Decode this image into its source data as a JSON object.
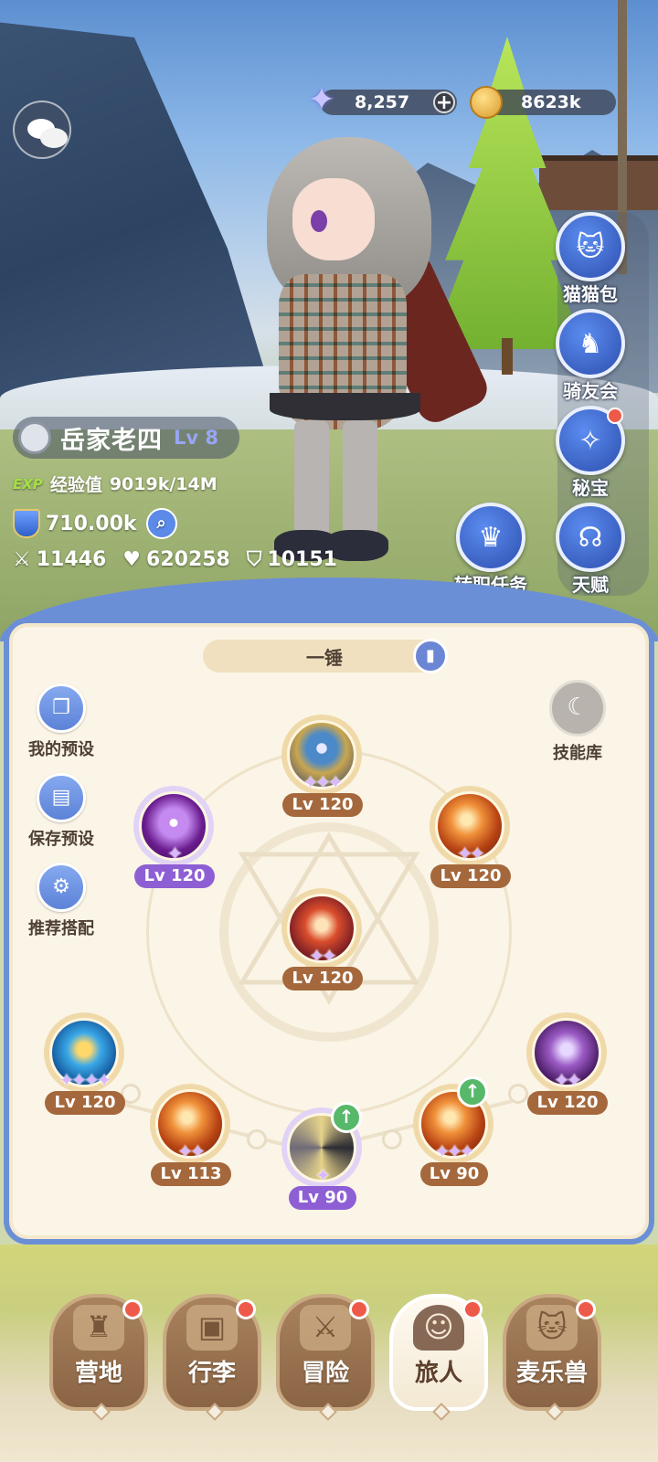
{
  "currency": {
    "gems": "8,257",
    "gold": "8623k"
  },
  "player": {
    "name": "岳家老四",
    "level": "Lv 8",
    "exp_tag": "EXP",
    "exp_label": "经验值",
    "exp_value": "9019k/14M",
    "power": "710.00k",
    "attack": "11446",
    "hp": "620258",
    "defense": "10151"
  },
  "right_menu": {
    "cat_bag": "猫猫包",
    "rider_club": "骑友会",
    "treasure": "秘宝",
    "talent": "天赋",
    "job_quest": "转职任务"
  },
  "panel": {
    "preset_name": "一锤",
    "my_presets": "我的预设",
    "save_preset": "保存预设",
    "recommended": "推荐搭配",
    "skill_library": "技能库"
  },
  "skills": [
    {
      "level": "Lv 120"
    },
    {
      "level": "Lv 120"
    },
    {
      "level": "Lv 120"
    },
    {
      "level": "Lv 120"
    },
    {
      "level": "Lv 120"
    },
    {
      "level": "Lv 120"
    },
    {
      "level": "Lv 113"
    },
    {
      "level": "Lv 90"
    },
    {
      "level": "Lv 90"
    }
  ],
  "nav": {
    "camp": "营地",
    "luggage": "行李",
    "adventure": "冒险",
    "traveler": "旅人",
    "mailebeast": "麦乐兽"
  },
  "colors": {
    "accent_blue": "#6b8fd6",
    "level_brown": "#a4683c",
    "level_purple": "#8e5fd4",
    "notify_red": "#ee5a4a",
    "upgrade_green": "#57b86a"
  }
}
